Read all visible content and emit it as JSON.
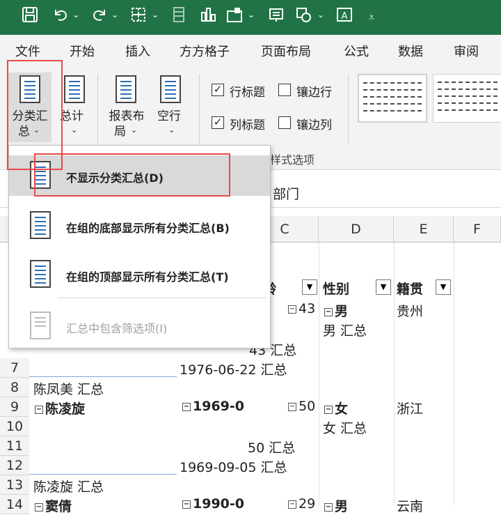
{
  "quick_access": {
    "icons": [
      "save-icon",
      "undo-icon",
      "redo-icon",
      "borders-icon",
      "format-painter-icon",
      "chart-icon",
      "insert-icon",
      "screenshot-icon",
      "shapes-icon",
      "textbox-icon",
      "customize-icon"
    ]
  },
  "tabs": [
    "文件",
    "开始",
    "插入",
    "方方格子",
    "页面布局",
    "公式",
    "数据",
    "审阅"
  ],
  "ribbon": {
    "subtotals": {
      "line1": "分类汇",
      "line2": "总"
    },
    "grand_totals": {
      "line1": "总计"
    },
    "report_layout": {
      "line1": "报表布",
      "line2": "局"
    },
    "blank_rows": {
      "line1": "空行"
    },
    "options": {
      "row_headers": "行标题",
      "banded_rows": "镶边行",
      "col_headers": "列标题",
      "banded_cols": "镶边列",
      "group_label": "表样式选项"
    },
    "checked": {
      "row_headers": true,
      "banded_rows": false,
      "col_headers": true,
      "banded_cols": false
    }
  },
  "formula_bar": {
    "value": "部门"
  },
  "menu": {
    "items": [
      {
        "label": "不显示分类汇总(D)",
        "enabled": true
      },
      {
        "label": "在组的底部显示所有分类汇总(B)",
        "enabled": true
      },
      {
        "label": "在组的顶部显示所有分类汇总(T)",
        "enabled": true
      },
      {
        "label": "汇总中包含筛选项(I)",
        "enabled": false
      }
    ]
  },
  "sheet": {
    "columns": [
      "C",
      "D",
      "E",
      "F"
    ],
    "rows": [
      "7",
      "8",
      "9",
      "10",
      "11",
      "12",
      "13",
      "14"
    ],
    "header_row": {
      "age": "龄",
      "gender": "性别",
      "origin": "籍贯"
    },
    "cells": {
      "r5_age": "43",
      "r5_gender": "男",
      "r5_origin": "贵州",
      "r6_gender_total": "男 汇总",
      "r6b_age_total": "43 汇总",
      "r7_date_total": "1976-06-22 汇总",
      "r8_name_total": "陈凤美 汇总",
      "r9_name": "陈凌旋",
      "r9_date": "1969-0",
      "r9_age": "50",
      "r9_gender": "女",
      "r9_origin": "浙江",
      "r10_gender_total": "女 汇总",
      "r11_age_total": "50 汇总",
      "r12_date_total": "1969-09-05 汇总",
      "r13_name_total": "陈凌旋 汇总",
      "r14_name": "窦倩",
      "r14_date": "1990-0",
      "r14_age": "29",
      "r14_gender": "男",
      "r14_origin": "云南"
    }
  }
}
